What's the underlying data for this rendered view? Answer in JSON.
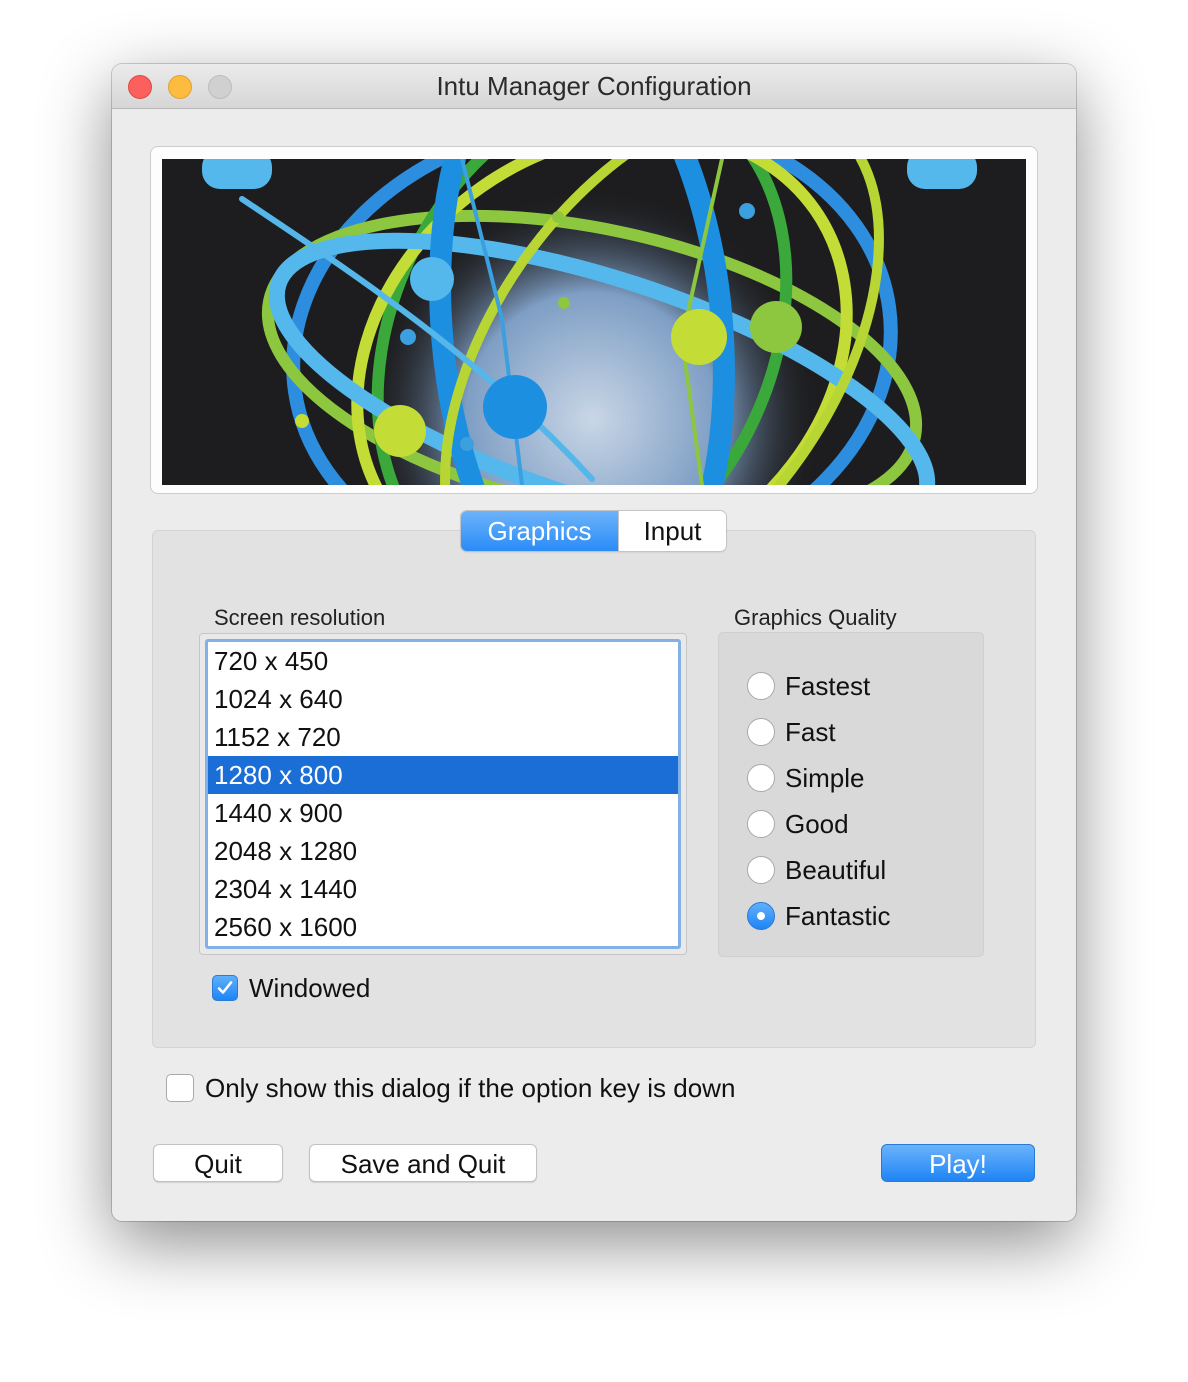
{
  "window": {
    "title": "Intu Manager Configuration"
  },
  "banner": {
    "description_icon": "atom-sphere-logo"
  },
  "tabs": [
    {
      "label": "Graphics",
      "selected": true
    },
    {
      "label": "Input",
      "selected": false
    }
  ],
  "graphics": {
    "resolution_label": "Screen resolution",
    "resolutions": [
      "720 x 450",
      "1024 x 640",
      "1152 x 720",
      "1280 x 800",
      "1440 x 900",
      "2048 x 1280",
      "2304 x 1440",
      "2560 x 1600"
    ],
    "selected_resolution": "1280 x 800",
    "quality_label": "Graphics Quality",
    "qualities": [
      "Fastest",
      "Fast",
      "Simple",
      "Good",
      "Beautiful",
      "Fantastic"
    ],
    "selected_quality": "Fantastic",
    "windowed_label": "Windowed",
    "windowed_checked": true
  },
  "option_key": {
    "label": "Only show this dialog if the option key is down",
    "checked": false
  },
  "buttons": {
    "quit": "Quit",
    "save_quit": "Save and Quit",
    "play": "Play!"
  },
  "colors": {
    "accent": "#1f84f5",
    "selection": "#1a6ed6",
    "close": "#fc605c",
    "minimize": "#fdbc40",
    "zoom_disabled": "#d0d0d0"
  }
}
